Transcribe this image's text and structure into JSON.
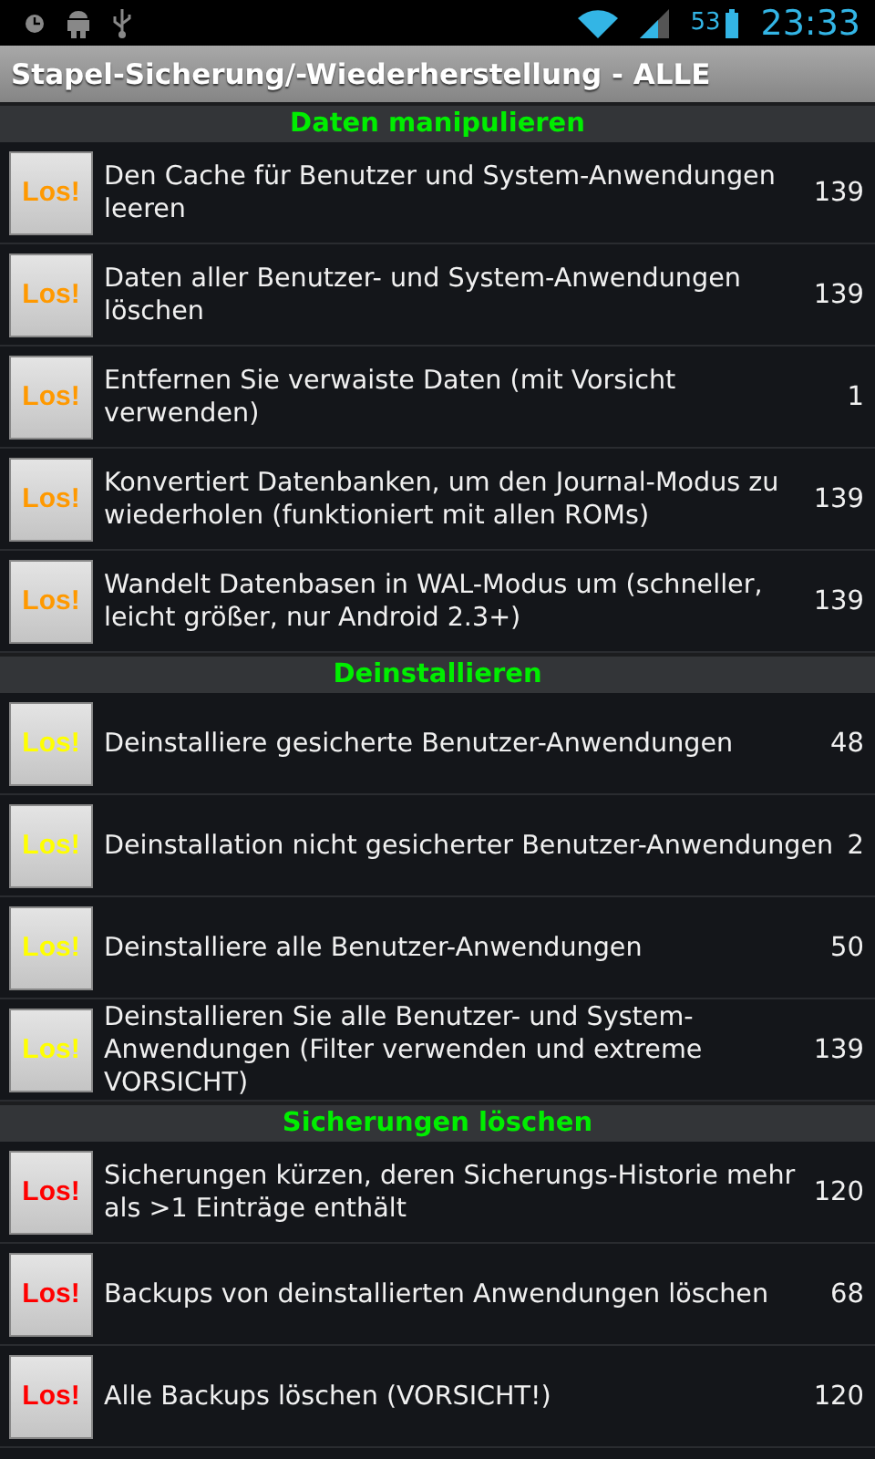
{
  "status_bar": {
    "battery_percent": "53",
    "time": "23:33"
  },
  "title": "Stapel-Sicherung/-Wiederherstellung - ALLE",
  "sections": [
    {
      "title": "Daten manipulieren",
      "color": "#ff9900",
      "rows": [
        {
          "button": "Los!",
          "label": "Den Cache für Benutzer und System-Anwendungen leeren",
          "count": "139"
        },
        {
          "button": "Los!",
          "label": "Daten aller Benutzer- und System-Anwendungen löschen",
          "count": "139"
        },
        {
          "button": "Los!",
          "label": "Entfernen Sie verwaiste Daten (mit Vorsicht verwenden)",
          "count": "1"
        },
        {
          "button": "Los!",
          "label": "Konvertiert Datenbanken, um den Journal-Modus zu wiederholen (funktioniert mit allen ROMs)",
          "count": "139"
        },
        {
          "button": "Los!",
          "label": "Wandelt Datenbasen in WAL-Modus um (schneller, leicht größer, nur Android 2.3+)",
          "count": "139"
        }
      ]
    },
    {
      "title": "Deinstallieren",
      "color": "#ffff00",
      "rows": [
        {
          "button": "Los!",
          "label": "Deinstalliere gesicherte Benutzer-Anwendungen",
          "count": "48"
        },
        {
          "button": "Los!",
          "label": "Deinstallation nicht gesicherter Benutzer-Anwendungen",
          "count": "2"
        },
        {
          "button": "Los!",
          "label": "Deinstalliere alle Benutzer-Anwendungen",
          "count": "50"
        },
        {
          "button": "Los!",
          "label": "Deinstallieren Sie alle Benutzer- und System-Anwendungen (Filter verwenden und extreme VORSICHT)",
          "count": "139"
        }
      ]
    },
    {
      "title": "Sicherungen löschen",
      "color": "#ff0000",
      "rows": [
        {
          "button": "Los!",
          "label": "Sicherungen kürzen, deren Sicherungs-Historie mehr als >1 Einträge enthält",
          "count": "120"
        },
        {
          "button": "Los!",
          "label": "Backups von deinstallierten Anwendungen löschen",
          "count": "68"
        },
        {
          "button": "Los!",
          "label": "Alle Backups löschen (VORSICHT!)",
          "count": "120"
        }
      ]
    }
  ]
}
